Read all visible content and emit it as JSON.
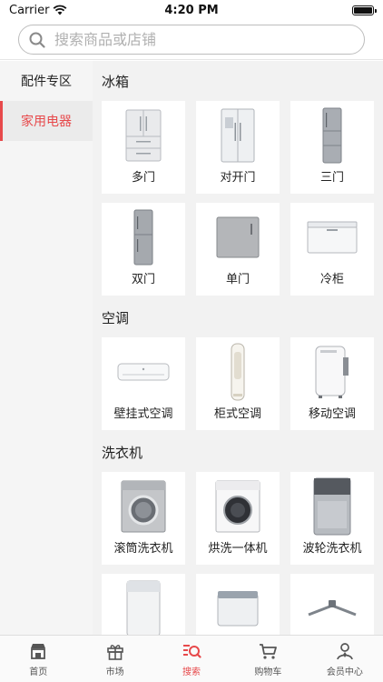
{
  "status_bar": {
    "carrier": "Carrier",
    "time": "4:20 PM"
  },
  "search": {
    "placeholder": "搜索商品或店铺"
  },
  "sidebar": {
    "items": [
      {
        "label": "配件专区",
        "active": false
      },
      {
        "label": "家用电器",
        "active": true
      }
    ]
  },
  "sections": [
    {
      "title": "冰箱",
      "items": [
        {
          "label": "多门",
          "icon": "french-door-fridge-icon"
        },
        {
          "label": "对开门",
          "icon": "side-by-side-fridge-icon"
        },
        {
          "label": "三门",
          "icon": "three-door-fridge-icon"
        },
        {
          "label": "双门",
          "icon": "two-door-fridge-icon"
        },
        {
          "label": "单门",
          "icon": "single-door-fridge-icon"
        },
        {
          "label": "冷柜",
          "icon": "chest-freezer-icon"
        }
      ]
    },
    {
      "title": "空调",
      "items": [
        {
          "label": "壁挂式空调",
          "icon": "wall-ac-icon"
        },
        {
          "label": "柜式空调",
          "icon": "tower-ac-icon"
        },
        {
          "label": "移动空调",
          "icon": "portable-ac-icon"
        }
      ]
    },
    {
      "title": "洗衣机",
      "items": [
        {
          "label": "滚筒洗衣机",
          "icon": "drum-washer-icon"
        },
        {
          "label": "烘洗一体机",
          "icon": "washer-dryer-icon"
        },
        {
          "label": "波轮洗衣机",
          "icon": "top-load-washer-icon"
        },
        {
          "label": "",
          "icon": "top-load-washer-white-icon"
        },
        {
          "label": "",
          "icon": "twin-tub-washer-icon"
        },
        {
          "label": "",
          "icon": "washer-stand-icon"
        }
      ]
    }
  ],
  "tabbar": {
    "items": [
      {
        "label": "首页",
        "icon": "store-icon",
        "active": false
      },
      {
        "label": "市场",
        "icon": "gift-icon",
        "active": false
      },
      {
        "label": "搜索",
        "icon": "search-list-icon",
        "active": true
      },
      {
        "label": "购物车",
        "icon": "cart-icon",
        "active": false
      },
      {
        "label": "会员中心",
        "icon": "member-icon",
        "active": false
      }
    ]
  },
  "colors": {
    "accent": "#e7494b",
    "sidebar_bg": "#f5f5f5",
    "content_bg": "#f2f2f2"
  }
}
